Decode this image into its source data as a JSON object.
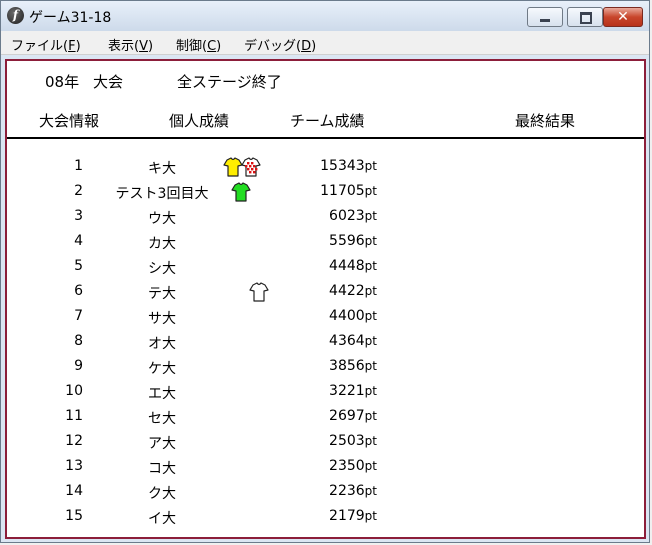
{
  "window": {
    "title": "ゲーム31-18",
    "close_glyph": "✕"
  },
  "menu": [
    {
      "label": "ファイル(",
      "accel": "F",
      "close": ")"
    },
    {
      "label": "表示(",
      "accel": "V",
      "close": ")"
    },
    {
      "label": "制御(",
      "accel": "C",
      "close": ")"
    },
    {
      "label": "デバッグ(",
      "accel": "D",
      "close": ")"
    }
  ],
  "status": {
    "year": "08年",
    "event": "大会",
    "message": "全ステージ終了"
  },
  "tabs": [
    "大会情報",
    "個人成績",
    "チーム成績",
    "最終結果"
  ],
  "score_unit": "pt",
  "standings": [
    {
      "rank": "1",
      "name": "キ大",
      "score": "15343",
      "jerseys": [
        "yellow-jersey",
        "polka-dot-jersey"
      ]
    },
    {
      "rank": "2",
      "name": "テスト3回目大",
      "score": "11705",
      "jerseys": [
        "green-jersey"
      ]
    },
    {
      "rank": "3",
      "name": "ウ大",
      "score": "6023",
      "jerseys": []
    },
    {
      "rank": "4",
      "name": "カ大",
      "score": "5596",
      "jerseys": []
    },
    {
      "rank": "5",
      "name": "シ大",
      "score": "4448",
      "jerseys": []
    },
    {
      "rank": "6",
      "name": "テ大",
      "score": "4422",
      "jerseys": [
        "white-jersey"
      ]
    },
    {
      "rank": "7",
      "name": "サ大",
      "score": "4400",
      "jerseys": []
    },
    {
      "rank": "8",
      "name": "オ大",
      "score": "4364",
      "jerseys": []
    },
    {
      "rank": "9",
      "name": "ケ大",
      "score": "3856",
      "jerseys": []
    },
    {
      "rank": "10",
      "name": "エ大",
      "score": "3221",
      "jerseys": []
    },
    {
      "rank": "11",
      "name": "セ大",
      "score": "2697",
      "jerseys": []
    },
    {
      "rank": "12",
      "name": "ア大",
      "score": "2503",
      "jerseys": []
    },
    {
      "rank": "13",
      "name": "コ大",
      "score": "2350",
      "jerseys": []
    },
    {
      "rank": "14",
      "name": "ク大",
      "score": "2236",
      "jerseys": []
    },
    {
      "rank": "15",
      "name": "イ大",
      "score": "2179",
      "jerseys": []
    }
  ],
  "colors": {
    "content_border": "#8c1e3a",
    "yellow_jersey": "#ffee00",
    "green_jersey": "#22dd22",
    "polka_dot_red": "#dd1111",
    "white_jersey": "#ffffff"
  }
}
